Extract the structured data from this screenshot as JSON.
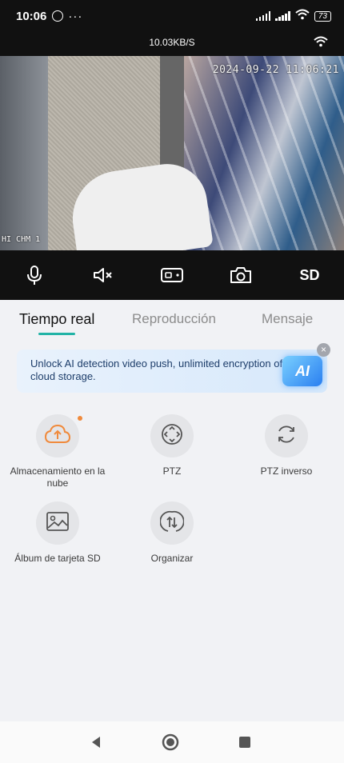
{
  "status_bar": {
    "time": "10:06",
    "more": "···",
    "battery": "73",
    "icons": [
      "whatsapp-icon",
      "signal-icon",
      "signal-icon",
      "wifi-icon",
      "battery-icon"
    ]
  },
  "info_bar": {
    "speed": "10.03KB/S",
    "icon": "wifi-icon"
  },
  "video": {
    "timestamp": "2024-09-22 11:06:21",
    "channel": "HI CHM 1"
  },
  "controls": {
    "icons": [
      "microphone-icon",
      "speaker-muted-icon",
      "record-video-icon",
      "camera-snapshot-icon"
    ],
    "quality_label": "SD"
  },
  "tabs": [
    {
      "label": "Tiempo real",
      "active": true
    },
    {
      "label": "Reproducción",
      "active": false
    },
    {
      "label": "Mensaje",
      "active": false
    }
  ],
  "banner": {
    "text": "Unlock AI detection video push, unlimited encryption of cloud storage.",
    "badge": "AI",
    "close": "×"
  },
  "features": [
    {
      "label": "Almacenamiento en la nube",
      "icon": "cloud-upload-icon",
      "accent": "#f08a3c",
      "notify": true
    },
    {
      "label": "PTZ",
      "icon": "ptz-icon"
    },
    {
      "label": "PTZ inverso",
      "icon": "rotate-icon"
    },
    {
      "label": "Álbum de tarjeta SD",
      "icon": "image-album-icon"
    },
    {
      "label": "Organizar",
      "icon": "sort-icon"
    }
  ],
  "colors": {
    "accent": "#22b3a6",
    "notify": "#f08a3c",
    "dark_bar": "#111111"
  }
}
